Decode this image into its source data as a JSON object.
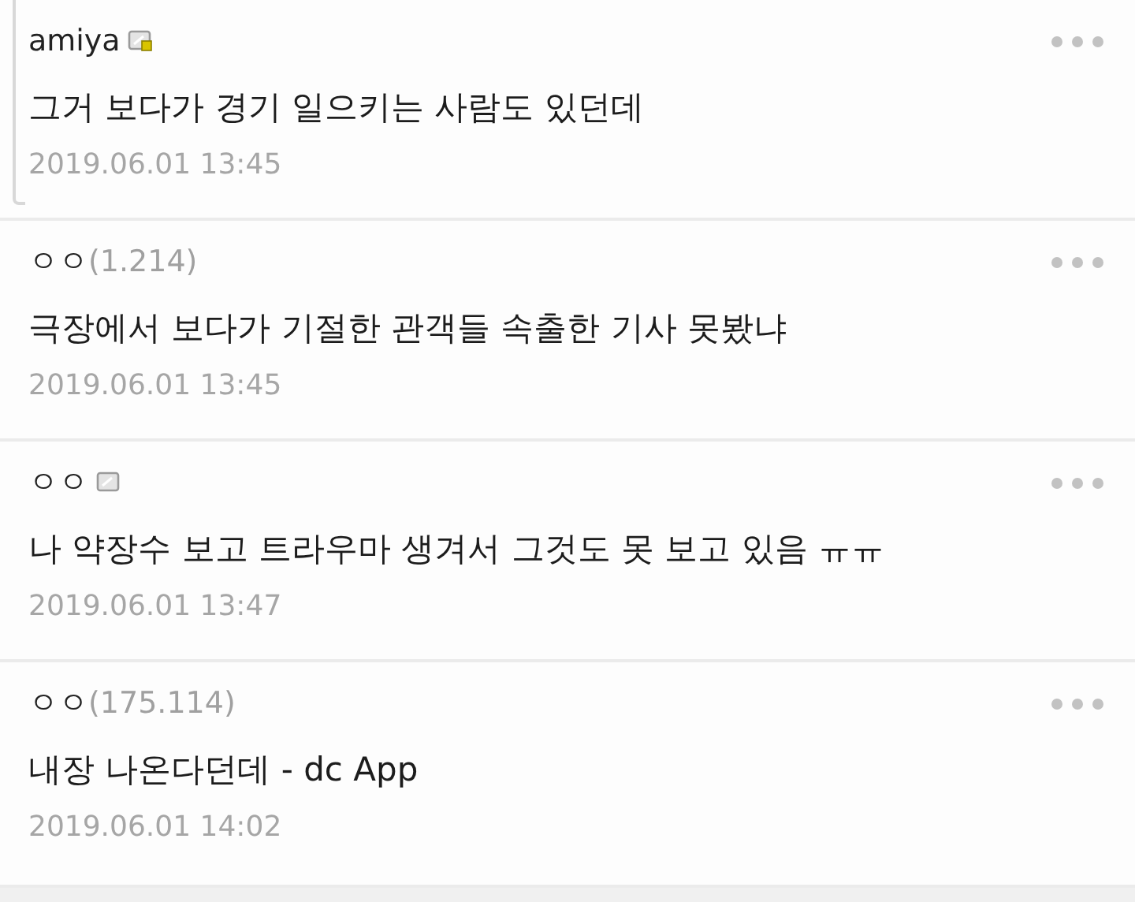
{
  "comments": [
    {
      "author": "amiya",
      "kind": "fixed",
      "text": "그거 보다가 경기 일으키는 사람도 있던데",
      "date": "2019.06.01 13:45",
      "reply_marker": true
    },
    {
      "author": "ㅇㅇ",
      "ip": "(1.214)",
      "kind": "guest",
      "text": "극장에서 보다가 기절한 관객들 속출한 기사 못봤냐",
      "date": "2019.06.01 13:45",
      "reply_marker": false
    },
    {
      "author": "ㅇㅇ",
      "kind": "half",
      "text": "나 약장수 보고 트라우마 생겨서 그것도 못 보고 있음 ㅠㅠ",
      "date": "2019.06.01 13:47",
      "reply_marker": false
    },
    {
      "author": "ㅇㅇ",
      "ip": "(175.114)",
      "kind": "guest",
      "text": "내장 나온다던데 - dc App",
      "date": "2019.06.01 14:02",
      "reply_marker": false
    }
  ]
}
